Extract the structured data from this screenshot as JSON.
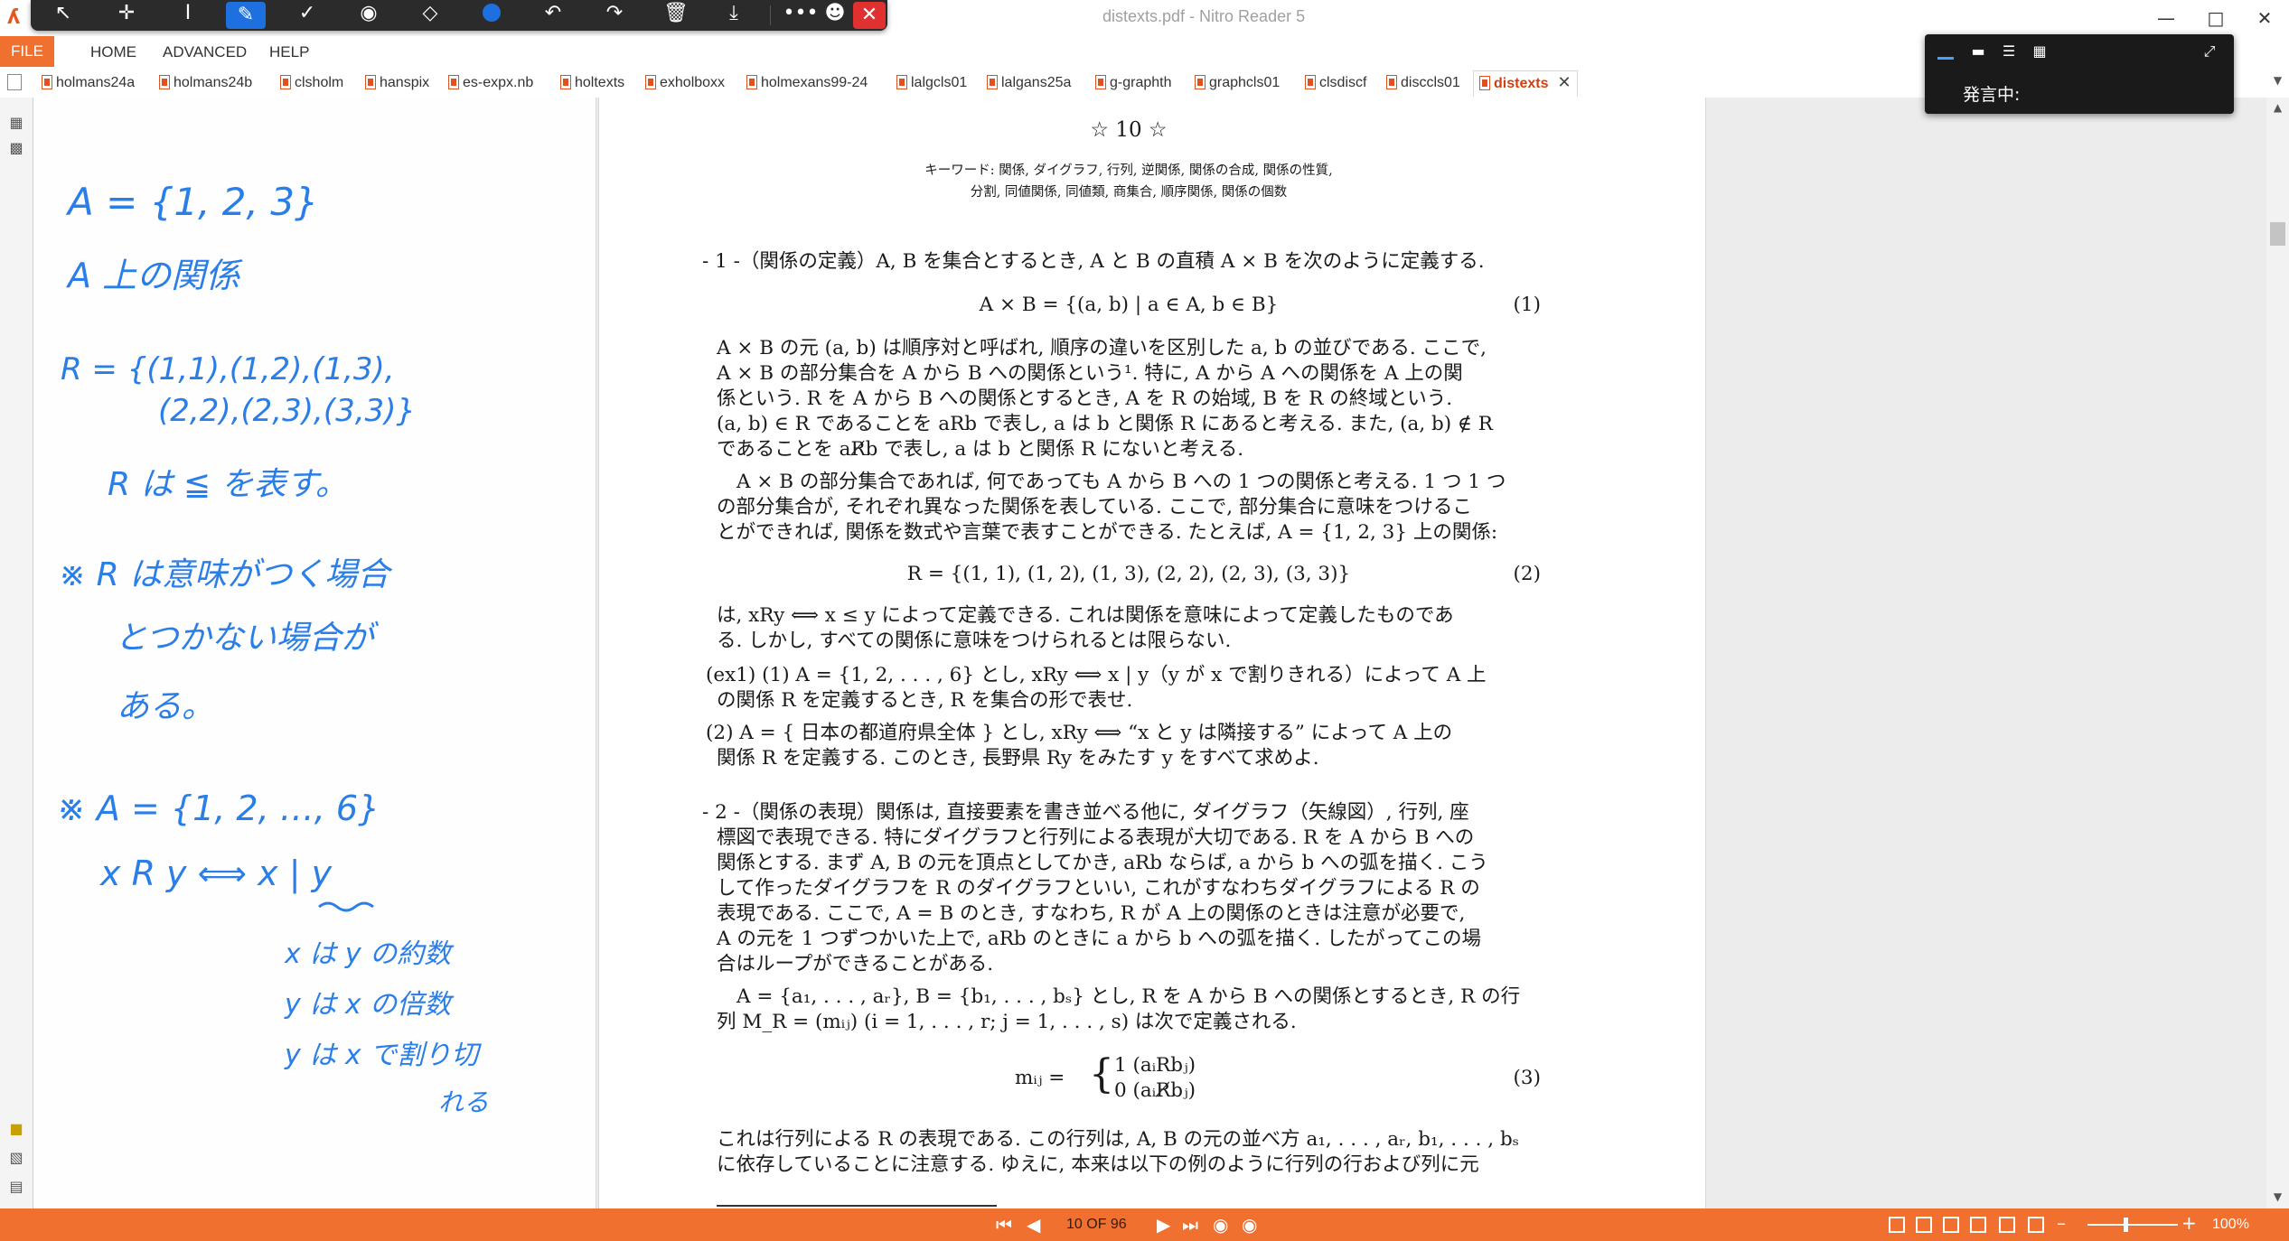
{
  "window": {
    "title": "distexts.pdf - Nitro Reader 5"
  },
  "pen_toolbar": {
    "tools": [
      "pointer-icon",
      "pan-icon",
      "text-cursor-icon",
      "pen-icon",
      "check-icon",
      "stamp-icon",
      "eraser-icon",
      "color-dot-icon",
      "undo-icon",
      "redo-icon",
      "trash-icon",
      "save-icon",
      "more-icon",
      "share-icon",
      "close-icon"
    ],
    "active_tool": "pen-icon",
    "active_color": "#1e6fe0"
  },
  "menu": {
    "file": "FILE",
    "home": "HOME",
    "advanced": "ADVANCED",
    "help": "HELP"
  },
  "tabs": [
    "holmans24a",
    "holmans24b",
    "clsholm",
    "hanspix",
    "es-expx.nb",
    "holtexts",
    "exholboxx",
    "holmexans99-24",
    "lalgcls01",
    "lalgans25a",
    "g-graphth",
    "graphcls01",
    "clsdiscf",
    "disccls01",
    "distexts"
  ],
  "active_tab": "distexts",
  "notes": [
    "A = {1, 2, 3}",
    "A 上の関係",
    "R = {(1,1),(1,2),(1,3),",
    "(2,2),(2,3),(3,3)}",
    "R は ≦ を表す。",
    "※ R は意味がつく場合",
    "とつかない場合が",
    "ある。",
    "※ A = {1, 2, …, 6}",
    "x R y ⟺ x | y",
    "x は y の約数",
    "y は x の倍数",
    "y は x で割り切",
    "れる"
  ],
  "page": {
    "heading": "☆ 10 ☆",
    "keywords_1": "キーワード: 関係, ダイグラフ, 行列, 逆関係, 関係の合成, 関係の性質,",
    "keywords_2": "分割, 同値関係, 同値類, 商集合, 順序関係, 関係の個数",
    "lines": [
      "- 1 -（関係の定義）A, B を集合とするとき, A と B の直積 A × B を次のように定義する.",
      "A × B = {(a, b) | a ∈ A, b ∈ B}",
      "A × B の元 (a, b) は順序対と呼ばれ, 順序の違いを区別した a, b の並びである. ここで,",
      "A × B の部分集合を A から B への関係という¹. 特に, A から A への関係を A 上の関",
      "係という. R を A から B への関係とするとき, A を R の始域, B を R の終域という.",
      "(a, b) ∈ R であることを aRb で表し, a は b と関係 R にあると考える. また, (a, b) ∉ R",
      "であることを aR̸b で表し, a は b と関係 R にないと考える.",
      "A × B の部分集合であれば, 何であっても A から B への 1 つの関係と考える. 1 つ 1 つ",
      "の部分集合が, それぞれ異なった関係を表している. ここで, 部分集合に意味をつけるこ",
      "とができれば, 関係を数式や言葉で表すことができる. たとえば, A = {1, 2, 3} 上の関係:",
      "R = {(1, 1), (1, 2), (1, 3), (2, 2), (2, 3), (3, 3)}",
      "は, xRy ⟺ x ≤ y によって定義できる. これは関係を意味によって定義したものであ",
      "る. しかし, すべての関係に意味をつけられるとは限らない.",
      "(ex1) (1) A = {1, 2, . . . , 6} とし, xRy ⟺ x | y（y が x で割りきれる）によって A 上",
      "の関係 R を定義するとき, R を集合の形で表せ.",
      "(2) A = { 日本の都道府県全体 } とし, xRy ⟺ “x と y は隣接する” によって A 上の",
      "関係 R を定義する. このとき, 長野県 Ry をみたす y をすべて求めよ.",
      "- 2 -（関係の表現）関係は, 直接要素を書き並べる他に, ダイグラフ（矢線図）, 行列, 座",
      "標図で表現できる. 特にダイグラフと行列による表現が大切である. R を A から B への",
      "関係とする. まず A, B の元を頂点としてかき, aRb ならば, a から b への弧を描く. こう",
      "して作ったダイグラフを R のダイグラフといい, これがすなわちダイグラフによる R の",
      "表現である. ここで, A = B のとき, すなわち, R が A 上の関係のときは注意が必要で,",
      "A の元を 1 つずつかいた上で, aRb のときに a から b への弧を描く. したがってこの場",
      "合はループができることがある.",
      "A = {a₁, . . . , aᵣ}, B = {b₁, . . . , bₛ} とし, R を A から B への関係とするとき, R の行",
      "列 M_R = (mᵢⱼ) (i = 1, . . . , r; j = 1, . . . , s) は次で定義される.",
      "mᵢⱼ =",
      "1    (aᵢRbⱼ)",
      "0    (aᵢR̸bⱼ)",
      "これは行列による R の表現である. この行列は, A, B の元の並べ方 a₁, . . . , aᵣ, b₁, . . . , bₛ",
      "に依存していることに注意する. ゆえに, 本来は以下の例のように行列の行および列に元"
    ],
    "eq_numbers": [
      "(1)",
      "(2)",
      "(3)"
    ]
  },
  "speech": {
    "label": "発言中:"
  },
  "status": {
    "page_indicator": "10 OF 96",
    "zoom": "100%",
    "zoom_fraction": 0.4
  }
}
